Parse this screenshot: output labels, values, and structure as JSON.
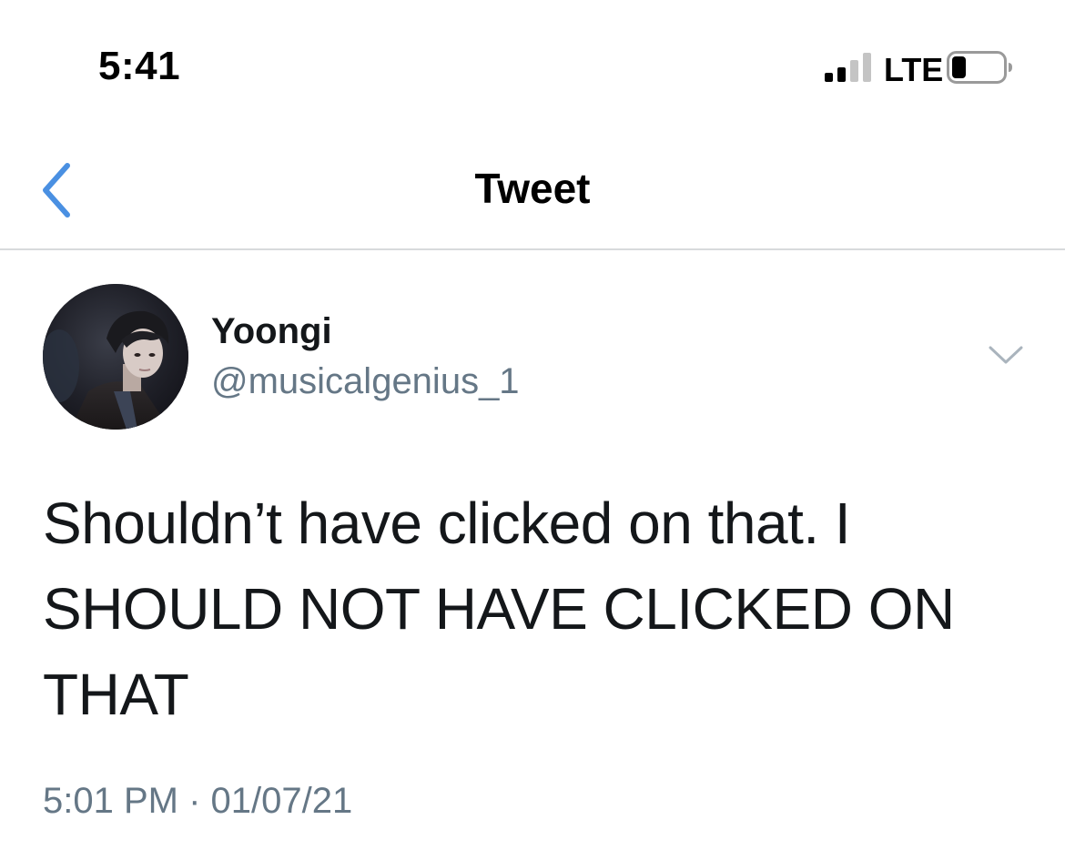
{
  "status_bar": {
    "time": "5:41",
    "network": "LTE",
    "signal_bars_active": 2,
    "signal_bars_total": 4,
    "battery_level": 0.25
  },
  "nav": {
    "title": "Tweet",
    "back_icon": "chevron-left-icon",
    "accent_color": "#4a90e2"
  },
  "tweet": {
    "display_name": "Yoongi",
    "username": "@musicalgenius_1",
    "text_lines": [
      "Shouldn’t have clicked on that. I",
      "SHOULD NOT HAVE CLICKED ON",
      "THAT"
    ],
    "time": "5:01 PM",
    "separator": "·",
    "date": "01/07/21",
    "menu_icon": "chevron-down-icon",
    "text_color": "#14171a",
    "secondary_color": "#657786"
  }
}
